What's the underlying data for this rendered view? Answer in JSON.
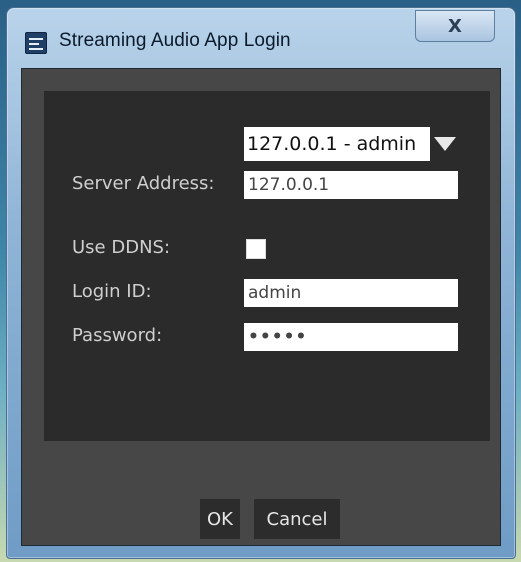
{
  "window": {
    "title": "Streaming Audio App Login",
    "close_label": "X"
  },
  "form": {
    "profile_select": {
      "value": "127.0.0.1 - admin"
    },
    "server_address": {
      "label": "Server Address:",
      "value": "127.0.0.1"
    },
    "use_ddns": {
      "label": "Use DDNS:",
      "checked": false
    },
    "login_id": {
      "label": "Login ID:",
      "value": "admin"
    },
    "password": {
      "label": "Password:",
      "value": "•••••"
    }
  },
  "buttons": {
    "ok_label": "OK",
    "cancel_label": "Cancel"
  },
  "icons": {
    "window_icon": "app-icon",
    "close_icon": "close-icon",
    "dropdown_icon": "dropdown-arrow-icon"
  },
  "colors": {
    "dialog_bg": "#474747",
    "panel_bg": "#2b2b2b",
    "label_text": "#cfcfcf",
    "button_bg": "#2c2c2c"
  }
}
